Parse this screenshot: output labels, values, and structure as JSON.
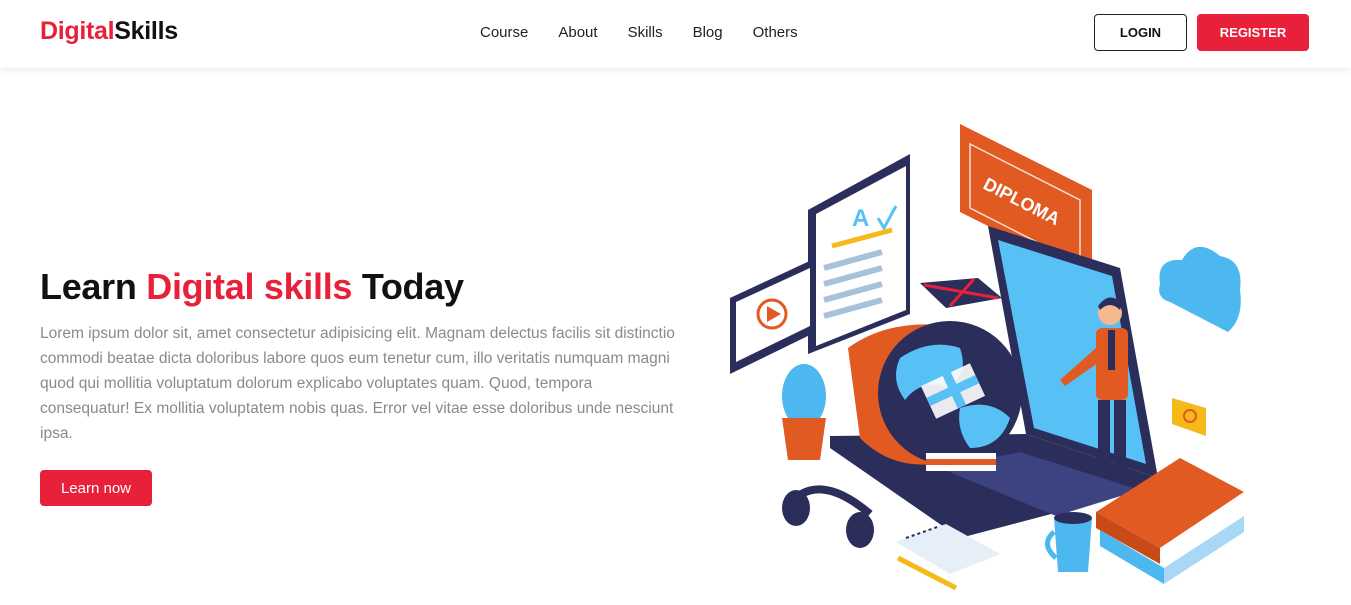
{
  "brand": {
    "part1": "Digital",
    "part2": "Skills"
  },
  "nav": {
    "items": [
      "Course",
      "About",
      "Skills",
      "Blog",
      "Others"
    ]
  },
  "header": {
    "login_label": "LOGIN",
    "register_label": "REGISTER"
  },
  "hero": {
    "title_part1": "Learn ",
    "title_highlight": "Digital skills",
    "title_part2": " Today",
    "description": "Lorem ipsum dolor sit, amet consectetur adipisicing elit. Magnam delectus facilis sit distinctio commodi beatae dicta doloribus labore quos eum tenetur cum, illo veritatis numquam magni quod qui mollitia voluptatum dolorum explicabo voluptates quam. Quod, tempora consequatur! Ex mollitia voluptatem nobis quas. Error vel vitae esse doloribus unde nesciunt ipsa.",
    "cta_label": "Learn now"
  },
  "illustration": {
    "diploma_text": "DIPLOMA",
    "test_grade": "A"
  },
  "colors": {
    "accent": "#e8203a",
    "text_dark": "#111111",
    "text_muted": "#8a8a8a",
    "navy": "#2b2d5b",
    "sky": "#4db8f0",
    "orange": "#e05a22"
  },
  "icons": [
    "diploma-icon",
    "cloud-icon",
    "video-play-icon",
    "quiz-sheet-icon",
    "globe-icon",
    "laptop-icon",
    "teacher-figure-icon",
    "cactus-icon",
    "headphones-icon",
    "notebook-icon",
    "pencil-icon",
    "mug-icon",
    "books-icon",
    "email-icon",
    "uk-flag-icon"
  ]
}
